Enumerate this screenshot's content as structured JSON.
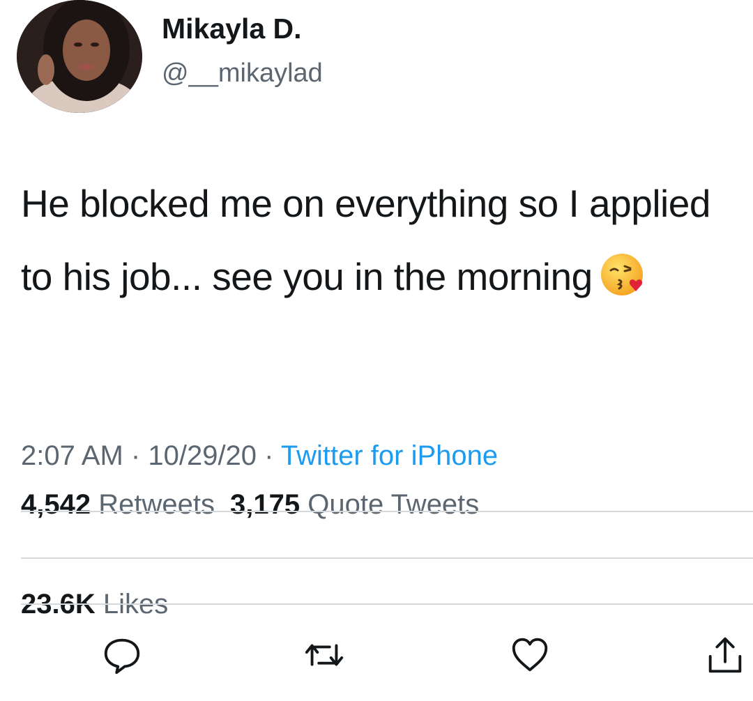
{
  "tweet": {
    "author": {
      "display_name": "Mikayla D.",
      "handle": "@__mikaylad",
      "avatar_icon": "profile-photo"
    },
    "text_before_emoji": "He blocked me on everything so I applied to his job... see you in the morning",
    "emoji_icon": "face-blowing-a-kiss-emoji",
    "meta": {
      "time": "2:07 AM",
      "separator": "·",
      "date": "10/29/20",
      "source": "Twitter for iPhone"
    },
    "stats": {
      "retweets_count": "4,542",
      "retweets_label": "Retweets",
      "quotes_count": "3,175",
      "quotes_label": "Quote Tweets",
      "likes_count": "23.6K",
      "likes_label": "Likes"
    },
    "actions": {
      "reply_icon": "reply-icon",
      "retweet_icon": "retweet-icon",
      "like_icon": "heart-icon",
      "share_icon": "share-icon"
    },
    "colors": {
      "text": "#14171a",
      "secondary": "#5b6670",
      "link": "#1d9bf0",
      "divider": "#d6d9dc"
    }
  }
}
